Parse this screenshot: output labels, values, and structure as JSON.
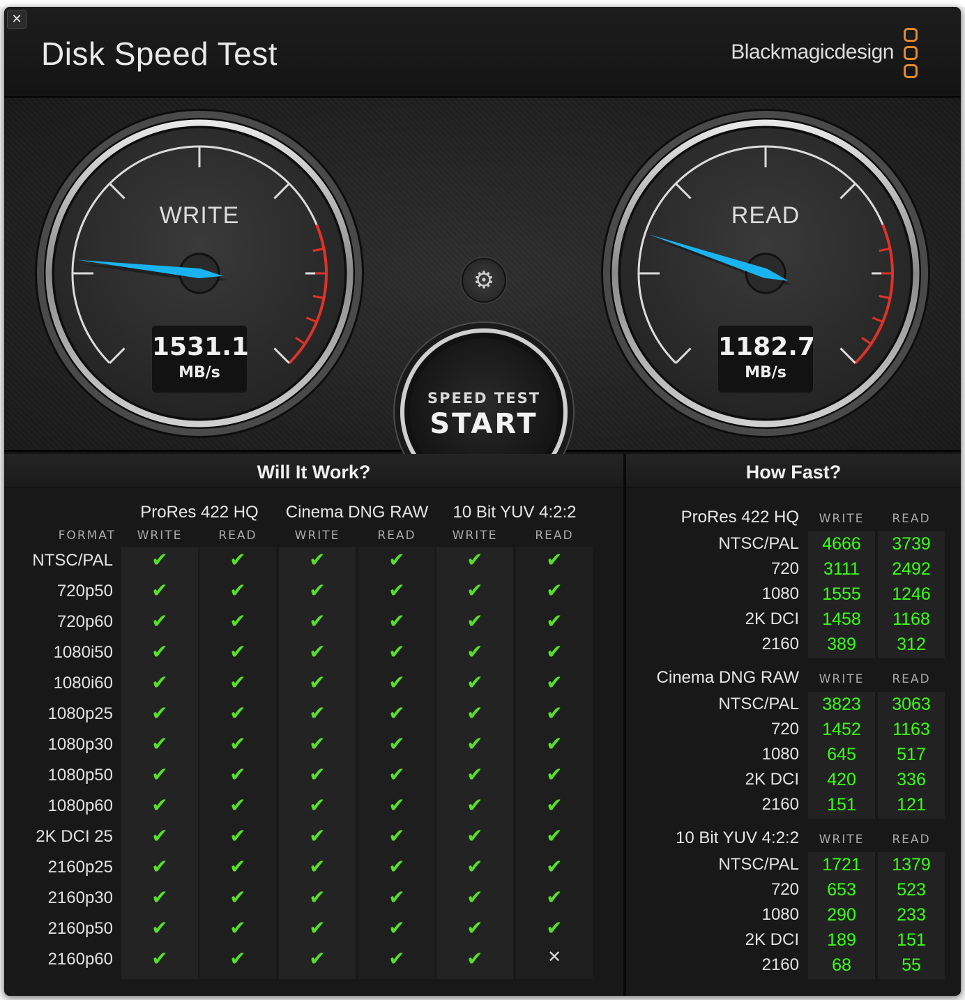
{
  "window": {
    "title": "Disk Speed Test",
    "brand": "Blackmagicdesign",
    "close_glyph": "✕"
  },
  "icons": {
    "close": "close-icon",
    "settings": "gear-icon",
    "check": "checkmark-icon",
    "cross": "cross-icon"
  },
  "colors": {
    "needle": "#19b4f0",
    "redline": "#e0322a",
    "ok": "#56e02a",
    "value": "#39ff14",
    "brand_logo": "#e38a2b"
  },
  "gauges": {
    "write": {
      "label": "WRITE",
      "value": "1531.1",
      "unit": "MB/s",
      "needle_fraction": 0.19
    },
    "read": {
      "label": "READ",
      "value": "1182.7",
      "unit": "MB/s",
      "needle_fraction": 0.235
    }
  },
  "start_button": {
    "line1": "SPEED TEST",
    "line2": "START"
  },
  "will_it_work": {
    "title": "Will It Work?",
    "format_header": "FORMAT",
    "groups": [
      "ProRes 422 HQ",
      "Cinema DNG RAW",
      "10 Bit YUV 4:2:2"
    ],
    "subcols": [
      "WRITE",
      "READ",
      "WRITE",
      "READ",
      "WRITE",
      "READ"
    ],
    "rows": [
      {
        "format": "NTSC/PAL",
        "results": [
          true,
          true,
          true,
          true,
          true,
          true
        ]
      },
      {
        "format": "720p50",
        "results": [
          true,
          true,
          true,
          true,
          true,
          true
        ]
      },
      {
        "format": "720p60",
        "results": [
          true,
          true,
          true,
          true,
          true,
          true
        ]
      },
      {
        "format": "1080i50",
        "results": [
          true,
          true,
          true,
          true,
          true,
          true
        ]
      },
      {
        "format": "1080i60",
        "results": [
          true,
          true,
          true,
          true,
          true,
          true
        ]
      },
      {
        "format": "1080p25",
        "results": [
          true,
          true,
          true,
          true,
          true,
          true
        ]
      },
      {
        "format": "1080p30",
        "results": [
          true,
          true,
          true,
          true,
          true,
          true
        ]
      },
      {
        "format": "1080p50",
        "results": [
          true,
          true,
          true,
          true,
          true,
          true
        ]
      },
      {
        "format": "1080p60",
        "results": [
          true,
          true,
          true,
          true,
          true,
          true
        ]
      },
      {
        "format": "2K DCI 25",
        "results": [
          true,
          true,
          true,
          true,
          true,
          true
        ]
      },
      {
        "format": "2160p25",
        "results": [
          true,
          true,
          true,
          true,
          true,
          true
        ]
      },
      {
        "format": "2160p30",
        "results": [
          true,
          true,
          true,
          true,
          true,
          true
        ]
      },
      {
        "format": "2160p50",
        "results": [
          true,
          true,
          true,
          true,
          true,
          true
        ]
      },
      {
        "format": "2160p60",
        "results": [
          true,
          true,
          true,
          true,
          true,
          false
        ]
      }
    ]
  },
  "how_fast": {
    "title": "How Fast?",
    "sections": [
      {
        "name": "ProRes 422 HQ",
        "headers": [
          "WRITE",
          "READ"
        ],
        "rows": [
          {
            "label": "NTSC/PAL",
            "write": "4666",
            "read": "3739"
          },
          {
            "label": "720",
            "write": "3111",
            "read": "2492"
          },
          {
            "label": "1080",
            "write": "1555",
            "read": "1246"
          },
          {
            "label": "2K DCI",
            "write": "1458",
            "read": "1168"
          },
          {
            "label": "2160",
            "write": "389",
            "read": "312"
          }
        ]
      },
      {
        "name": "Cinema DNG RAW",
        "headers": [
          "WRITE",
          "READ"
        ],
        "rows": [
          {
            "label": "NTSC/PAL",
            "write": "3823",
            "read": "3063"
          },
          {
            "label": "720",
            "write": "1452",
            "read": "1163"
          },
          {
            "label": "1080",
            "write": "645",
            "read": "517"
          },
          {
            "label": "2K DCI",
            "write": "420",
            "read": "336"
          },
          {
            "label": "2160",
            "write": "151",
            "read": "121"
          }
        ]
      },
      {
        "name": "10 Bit YUV 4:2:2",
        "headers": [
          "WRITE",
          "READ"
        ],
        "rows": [
          {
            "label": "NTSC/PAL",
            "write": "1721",
            "read": "1379"
          },
          {
            "label": "720",
            "write": "653",
            "read": "523"
          },
          {
            "label": "1080",
            "write": "290",
            "read": "233"
          },
          {
            "label": "2K DCI",
            "write": "189",
            "read": "151"
          },
          {
            "label": "2160",
            "write": "68",
            "read": "55"
          }
        ]
      }
    ]
  }
}
